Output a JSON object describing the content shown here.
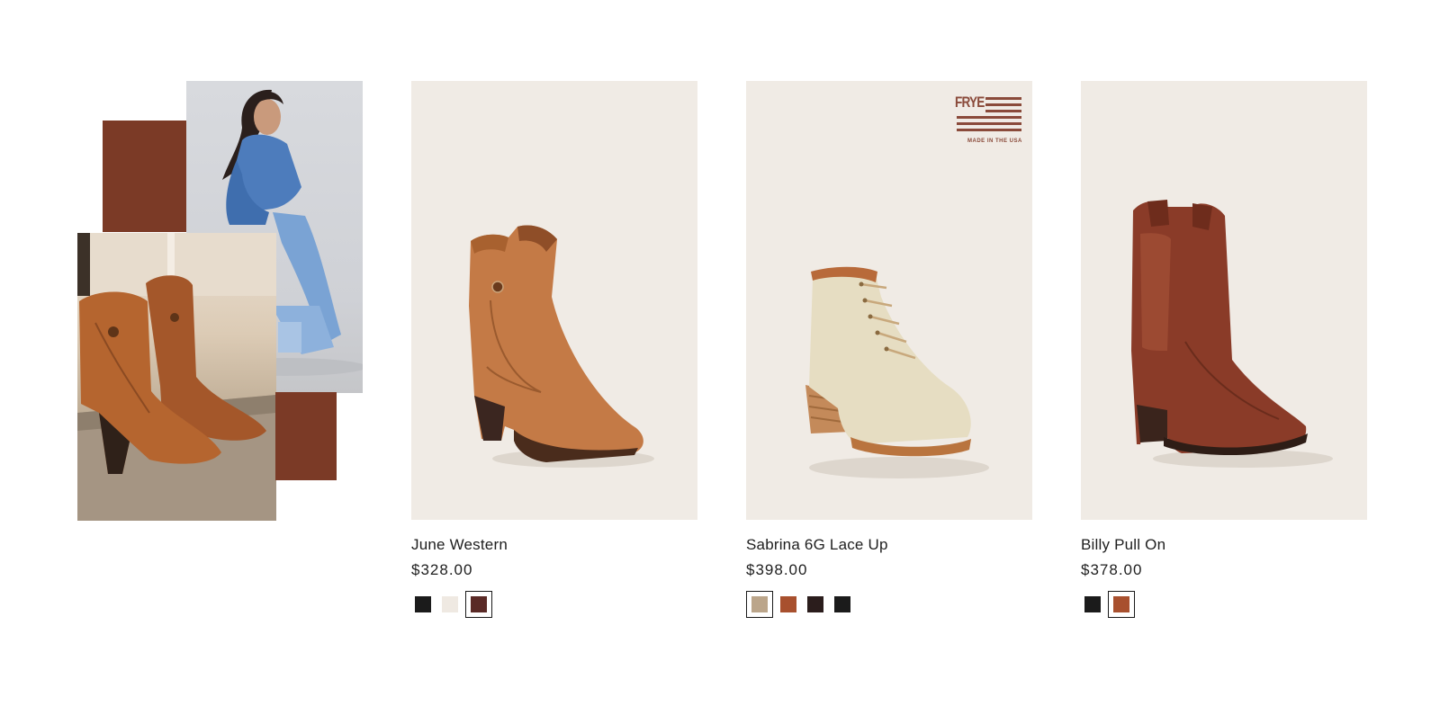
{
  "collage": {
    "accent_color": "#7b3a26"
  },
  "products": [
    {
      "name": "June Western",
      "price": "$328.00",
      "swatches": [
        {
          "color": "#1b1b1b",
          "selected": false
        },
        {
          "color": "#efe9e2",
          "selected": false
        },
        {
          "color": "#5a2a26",
          "selected": true
        }
      ]
    },
    {
      "name": "Sabrina 6G Lace Up",
      "price": "$398.00",
      "badge": {
        "brand": "FRYE",
        "caption": "MADE IN THE USA"
      },
      "swatches": [
        {
          "color": "#bba58a",
          "selected": true
        },
        {
          "color": "#a8502e",
          "selected": false
        },
        {
          "color": "#2b1d1c",
          "selected": false
        },
        {
          "color": "#1b1b1b",
          "selected": false
        }
      ]
    },
    {
      "name": "Billy Pull On",
      "price": "$378.00",
      "swatches": [
        {
          "color": "#1b1b1b",
          "selected": false
        },
        {
          "color": "#a8502e",
          "selected": true
        }
      ]
    }
  ]
}
